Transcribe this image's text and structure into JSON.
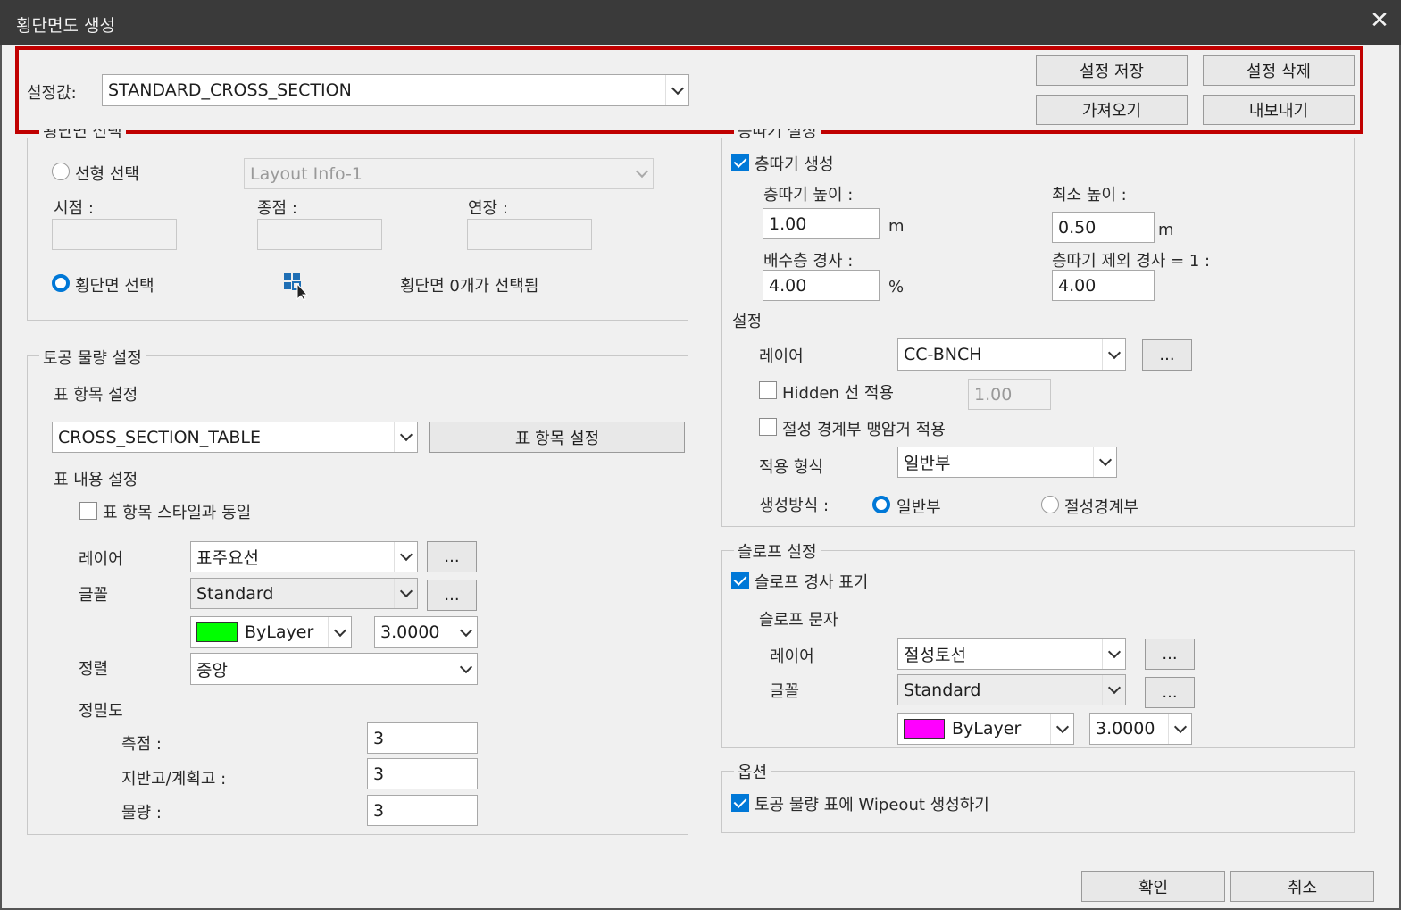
{
  "window": {
    "title": "횡단면도 생성",
    "close_glyph": "✕"
  },
  "settings": {
    "label": "설정값:",
    "value": "STANDARD_CROSS_SECTION",
    "save": "설정 저장",
    "delete": "설정 삭제",
    "import": "가져오기",
    "export": "내보내기"
  },
  "section_select": {
    "title": "횡단면 선택",
    "alignment_radio": "선형 선택",
    "alignment_value": "Layout Info-1",
    "start_label": "시점 :",
    "end_label": "종점 :",
    "ext_label": "연장 :",
    "cross_radio": "횡단면 선택",
    "status": "횡단면 0개가 선택됨"
  },
  "earthwork": {
    "title": "토공 물량 설정",
    "table_items_label": "표 항목 설정",
    "table_value": "CROSS_SECTION_TABLE",
    "table_items_button": "표 항목 설정",
    "content_label": "표 내용 설정",
    "same_style_check": "표 항목 스타일과 동일",
    "layer_label": "레이어",
    "layer_value": "표주요선",
    "font_label": "글꼴",
    "font_value": "Standard",
    "color_value": "ByLayer",
    "color_hex": "#00ff00",
    "size_value": "3.0000",
    "align_label": "정렬",
    "align_value": "중앙",
    "precision_label": "정밀도",
    "station_label": "측점 :",
    "station_value": "3",
    "ground_label": "지반고/계획고 :",
    "ground_value": "3",
    "quantity_label": "물량 :",
    "quantity_value": "3",
    "more": "..."
  },
  "bench": {
    "title": "층따기 설정",
    "create_check": "층따기 생성",
    "height_label": "층따기 높이 :",
    "height_value": "1.00",
    "height_unit": "m",
    "min_height_label": "최소 높이 :",
    "min_height_value": "0.50",
    "min_height_unit": "m",
    "drain_slope_label": "배수층 경사 :",
    "drain_slope_value": "4.00",
    "drain_slope_unit": "%",
    "exclude_slope_label": "층따기 제외 경사 = 1 :",
    "exclude_slope_value": "4.00",
    "settings_label": "설정",
    "layer_label": "레이어",
    "layer_value": "CC-BNCH",
    "hidden_check": "Hidden 선 적용",
    "hidden_value": "1.00",
    "cut_check": "절성 경계부 맹암거 적용",
    "apply_form_label": "적용 형식",
    "apply_form_value": "일반부",
    "method_label": "생성방식 :",
    "method_general": "일반부",
    "method_boundary": "절성경계부",
    "more": "..."
  },
  "slope": {
    "title": "슬로프 설정",
    "show_check": "슬로프 경사 표기",
    "text_label": "슬로프 문자",
    "layer_label": "레이어",
    "layer_value": "절성토선",
    "font_label": "글꼴",
    "font_value": "Standard",
    "color_value": "ByLayer",
    "color_hex": "#ff00ff",
    "size_value": "3.0000",
    "more": "..."
  },
  "options": {
    "title": "옵션",
    "wipeout_check": "토공 물량 표에 Wipeout 생성하기"
  },
  "footer": {
    "ok": "확인",
    "cancel": "취소"
  }
}
